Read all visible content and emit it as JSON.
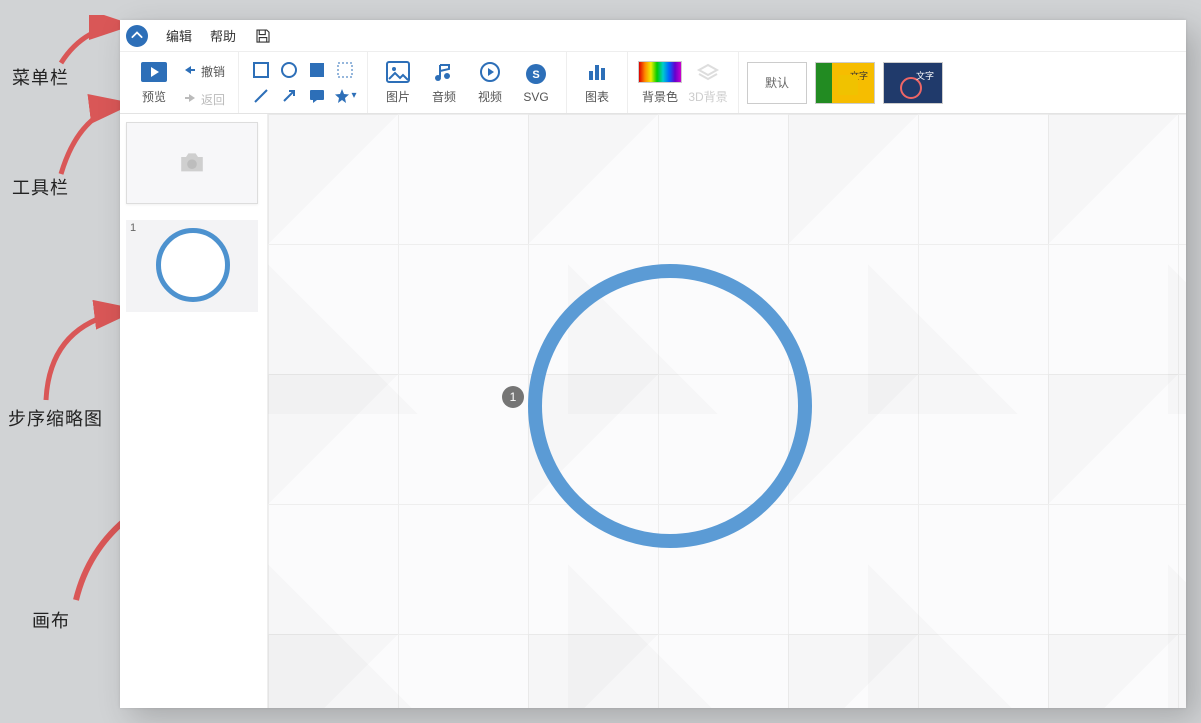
{
  "menubar": {
    "edit": "编辑",
    "help": "帮助"
  },
  "toolbar": {
    "preview": "预览",
    "undo": "撤销",
    "back": "返回",
    "image": "图片",
    "audio": "音频",
    "video": "视频",
    "svg": "SVG",
    "chart": "图表",
    "bgcolor": "背景色",
    "bg3d": "3D背景",
    "template_default": "默认",
    "template_text": "文字"
  },
  "sidebar": {
    "step1_number": "1"
  },
  "canvas": {
    "step_badge": "1"
  },
  "annotations": {
    "menubar": "菜单栏",
    "toolbar": "工具栏",
    "thumbs": "步序缩略图",
    "canvas": "画布"
  }
}
